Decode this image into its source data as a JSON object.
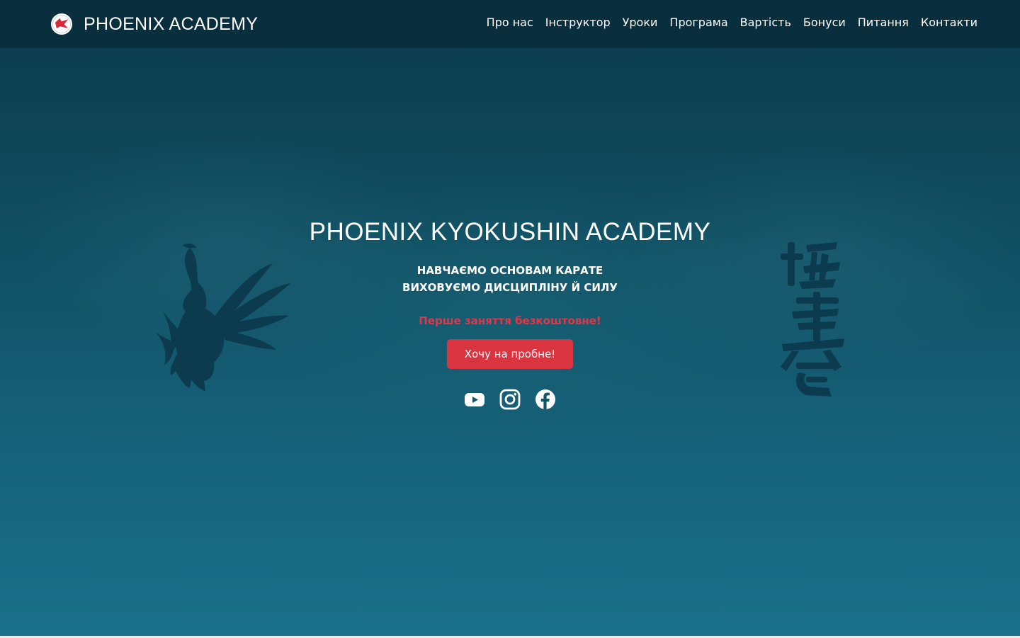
{
  "header": {
    "brand_name": "PHOENIX ACADEMY",
    "logo_icon": "phoenix-logo-icon",
    "nav": [
      {
        "label": "Про нас"
      },
      {
        "label": "Інструктор"
      },
      {
        "label": "Уроки"
      },
      {
        "label": "Програма"
      },
      {
        "label": "Вартість"
      },
      {
        "label": "Бонуси"
      },
      {
        "label": "Питання"
      },
      {
        "label": "Контакти"
      }
    ]
  },
  "hero": {
    "title": "PHOENIX KYOKUSHIN ACADEMY",
    "subtitle_line1": "НАВЧАЄМО ОСНОВАМ КАРАТЕ",
    "subtitle_line2": "ВИХОВУЄМО ДИСЦИПЛІНУ Й СИЛУ",
    "promo": "Перше заняття безкоштовне!",
    "cta_label": "Хочу на пробне!",
    "social": [
      {
        "icon": "youtube-icon"
      },
      {
        "icon": "instagram-icon"
      },
      {
        "icon": "facebook-icon"
      }
    ]
  },
  "colors": {
    "accent": "#d9343f",
    "promo_text": "#e0384a",
    "header_bg": "#0a2e3c",
    "hero_top": "#0b3a4b",
    "hero_bottom": "#1a7089",
    "art": "#0c3a4e"
  }
}
